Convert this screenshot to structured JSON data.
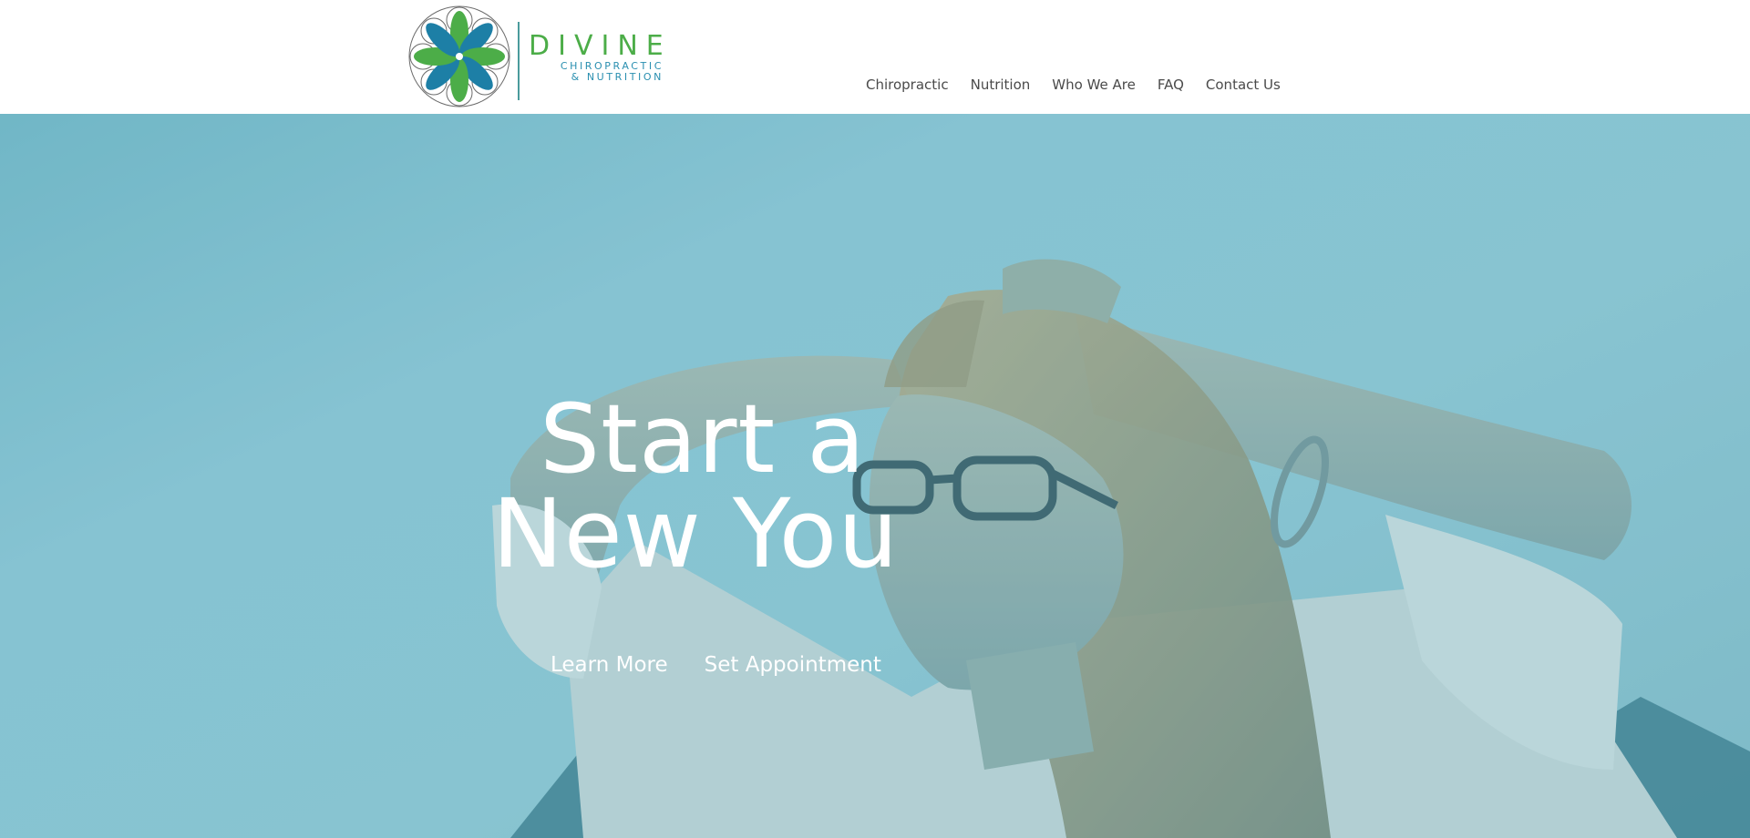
{
  "brand": {
    "name": "DIVINE",
    "tagline_line1": "CHIROPRACTIC",
    "tagline_line2": "& NUTRITION",
    "colors": {
      "green": "#4cad48",
      "blue": "#1d7fa6",
      "teal": "#2a8fb0"
    }
  },
  "nav": {
    "items": [
      {
        "label": "Chiropractic"
      },
      {
        "label": "Nutrition"
      },
      {
        "label": "Who We Are"
      },
      {
        "label": "FAQ"
      },
      {
        "label": "Contact Us"
      }
    ]
  },
  "hero": {
    "title_line1": "Start a",
    "title_line2": "New You",
    "buttons": [
      {
        "label": "Learn More"
      },
      {
        "label": "Set Appointment"
      }
    ],
    "overlay_color": "#8fc6d3"
  }
}
